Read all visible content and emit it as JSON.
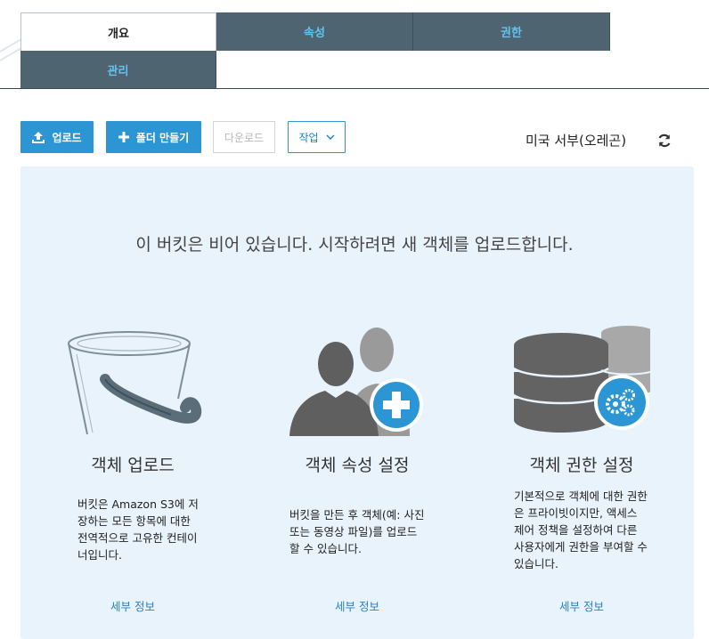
{
  "tabs": [
    {
      "label": "개요",
      "active": true
    },
    {
      "label": "속성",
      "active": false
    },
    {
      "label": "권한",
      "active": false
    },
    {
      "label": "관리",
      "active": false
    }
  ],
  "toolbar": {
    "upload_label": "업로드",
    "create_folder_label": "폴더 만들기",
    "download_label": "다운로드",
    "actions_label": "작업",
    "region_label": "미국 서부(오레곤)"
  },
  "panel": {
    "empty_message": "이 버킷은 비어 있습니다. 시작하려면 새 객체를 업로드합니다.",
    "cards": [
      {
        "icon": "bucket-icon",
        "title": "객체 업로드",
        "description": "버킷은 Amazon S3에 저장하는 모든 항목에 대한 전역적으로 고유한 컨테이너입니다.",
        "link": "세부 정보"
      },
      {
        "icon": "users-add-icon",
        "title": "객체 속성 설정",
        "description": "버킷을 만든 후 객체(예: 사진 또는 동영상 파일)를 업로드할 수 있습니다.",
        "link": "세부 정보"
      },
      {
        "icon": "database-settings-icon",
        "title": "객체 권한 설정",
        "description": "기본적으로 객체에 대한 권한은 프라이빗이지만, 액세스 제어 정책을 설정하여 다른 사용자에게 권한을 부여할 수 있습니다.",
        "link": "세부 정보"
      }
    ]
  },
  "colors": {
    "tab_bg": "#4e6471",
    "tab_text": "#63c3ef",
    "primary": "#2b96d3",
    "panel_bg": "#e8f3fb",
    "link": "#2b7fc0"
  }
}
